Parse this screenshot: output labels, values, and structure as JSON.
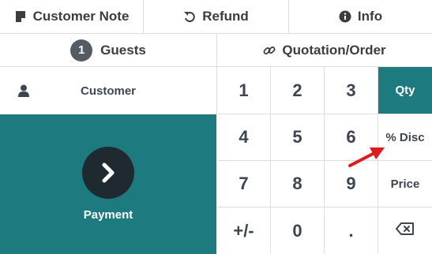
{
  "top_bar": {
    "customer_note": "Customer Note",
    "refund": "Refund",
    "info": "Info"
  },
  "second_bar": {
    "guests_count": "1",
    "guests_label": "Guests",
    "quotation_order": "Quotation/Order"
  },
  "customer": {
    "label": "Customer"
  },
  "payment": {
    "label": "Payment"
  },
  "numpad": {
    "keys": [
      "1",
      "2",
      "3",
      "4",
      "5",
      "6",
      "7",
      "8",
      "9",
      "+/-",
      "0",
      "."
    ],
    "modes": [
      "Qty",
      "% Disc",
      "Price"
    ],
    "active_mode": "Qty"
  },
  "icons": {
    "customer_note": "note-icon",
    "refund": "undo-icon",
    "info": "info-circle-icon",
    "quotation_order": "link-icon",
    "customer": "user-icon",
    "payment": "chevron-right-icon",
    "backspace": "backspace-icon",
    "annotation": "red-arrow-icon"
  },
  "colors": {
    "accent": "#1d7b7f",
    "payment_button": "#1f2a30",
    "annotation_arrow": "#e01b1b"
  }
}
